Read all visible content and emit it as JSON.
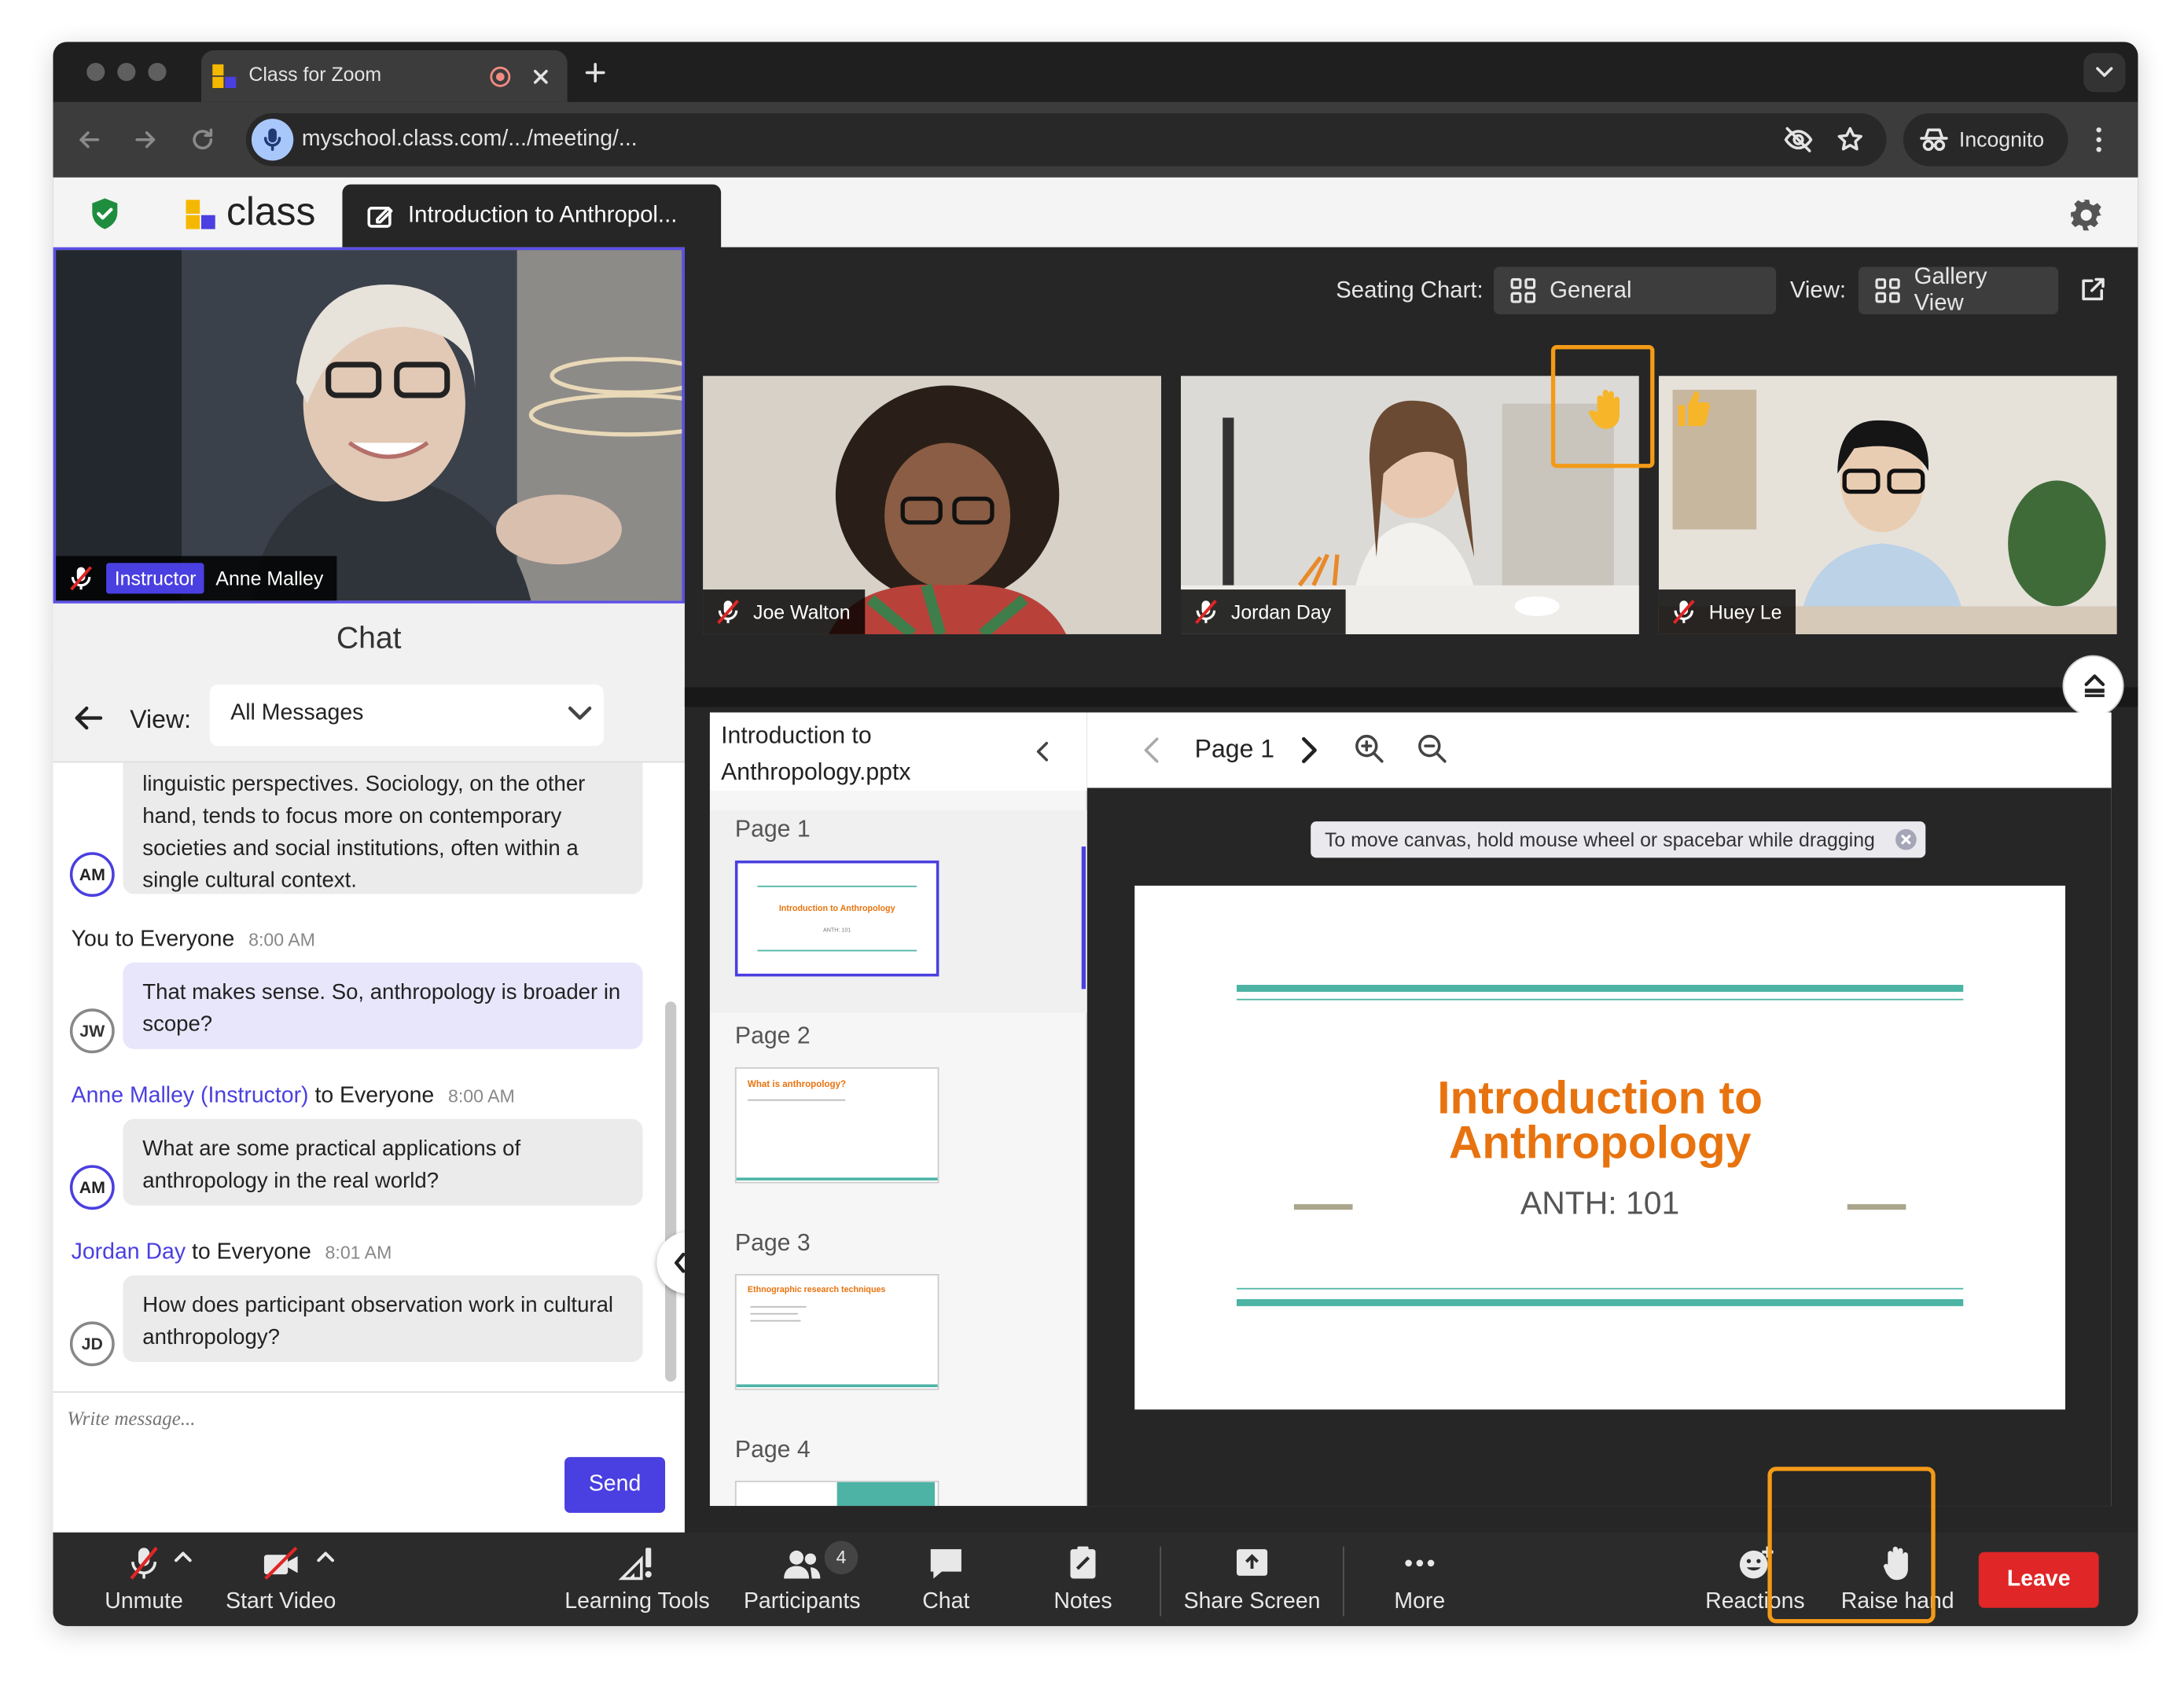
{
  "browser": {
    "tab_title": "Class for Zoom",
    "url": "myschool.class.com/.../meeting/...",
    "incognito_label": "Incognito"
  },
  "app": {
    "brand": "class",
    "meeting_tab_title": "Introduction to Anthropol..."
  },
  "instructor_video": {
    "badge": "Instructor",
    "name": "Anne Malley"
  },
  "chat": {
    "title": "Chat",
    "view_label": "View:",
    "view_value": "All Messages",
    "messages": [
      {
        "text": "linguistic perspectives. Sociology, on the other hand, tends to focus more on contemporary societies and social institutions, often within a single cultural context.",
        "avatar": "AM"
      },
      {
        "sender": "You",
        "to": "to Everyone",
        "time": "8:00 AM",
        "text": "That makes sense. So, anthropology is broader in scope?",
        "avatar": "JW"
      },
      {
        "sender": "Anne Malley (Instructor)",
        "to": "to Everyone",
        "time": "8:00 AM",
        "text": "What are some practical applications of anthropology in the real world?",
        "avatar": "AM"
      },
      {
        "sender": "Jordan Day",
        "to": "to Everyone",
        "time": "8:01 AM",
        "text": "How does participant observation work in cultural anthropology?",
        "avatar": "JD"
      }
    ],
    "compose_placeholder": "Write message...",
    "send_label": "Send"
  },
  "seating": {
    "label": "Seating Chart:",
    "value": "General",
    "view_label": "View:",
    "view_value": "Gallery View"
  },
  "participants_video": [
    {
      "name": "Joe Walton"
    },
    {
      "name": "Jordan Day"
    },
    {
      "name": "Huey Le"
    }
  ],
  "document": {
    "filename": "Introduction to Anthropology.pptx",
    "pages": [
      "Page 1",
      "Page 2",
      "Page 3",
      "Page 4"
    ],
    "current_page": "Page 1",
    "hint": "To move canvas, hold mouse wheel or spacebar while dragging",
    "thumb_titles": [
      "Introduction to Anthropology",
      "What is anthropology?",
      "Ethnographic research techniques"
    ],
    "thumb_subtitle": "ANTH: 101",
    "slide_title_line1": "Introduction to",
    "slide_title_line2": "Anthropology",
    "slide_subtitle": "ANTH: 101"
  },
  "toolbar": {
    "unmute": "Unmute",
    "start_video": "Start Video",
    "learning_tools": "Learning Tools",
    "participants": "Participants",
    "participants_count": "4",
    "chat": "Chat",
    "notes": "Notes",
    "share_screen": "Share Screen",
    "more": "More",
    "reactions": "Reactions",
    "raise_hand": "Raise hand",
    "leave": "Leave"
  },
  "colors": {
    "accent": "#4a3fe0",
    "highlight": "#f39a17",
    "leave": "#e02626",
    "slide_title": "#e8730e",
    "slide_rule": "#4cb3a5"
  }
}
